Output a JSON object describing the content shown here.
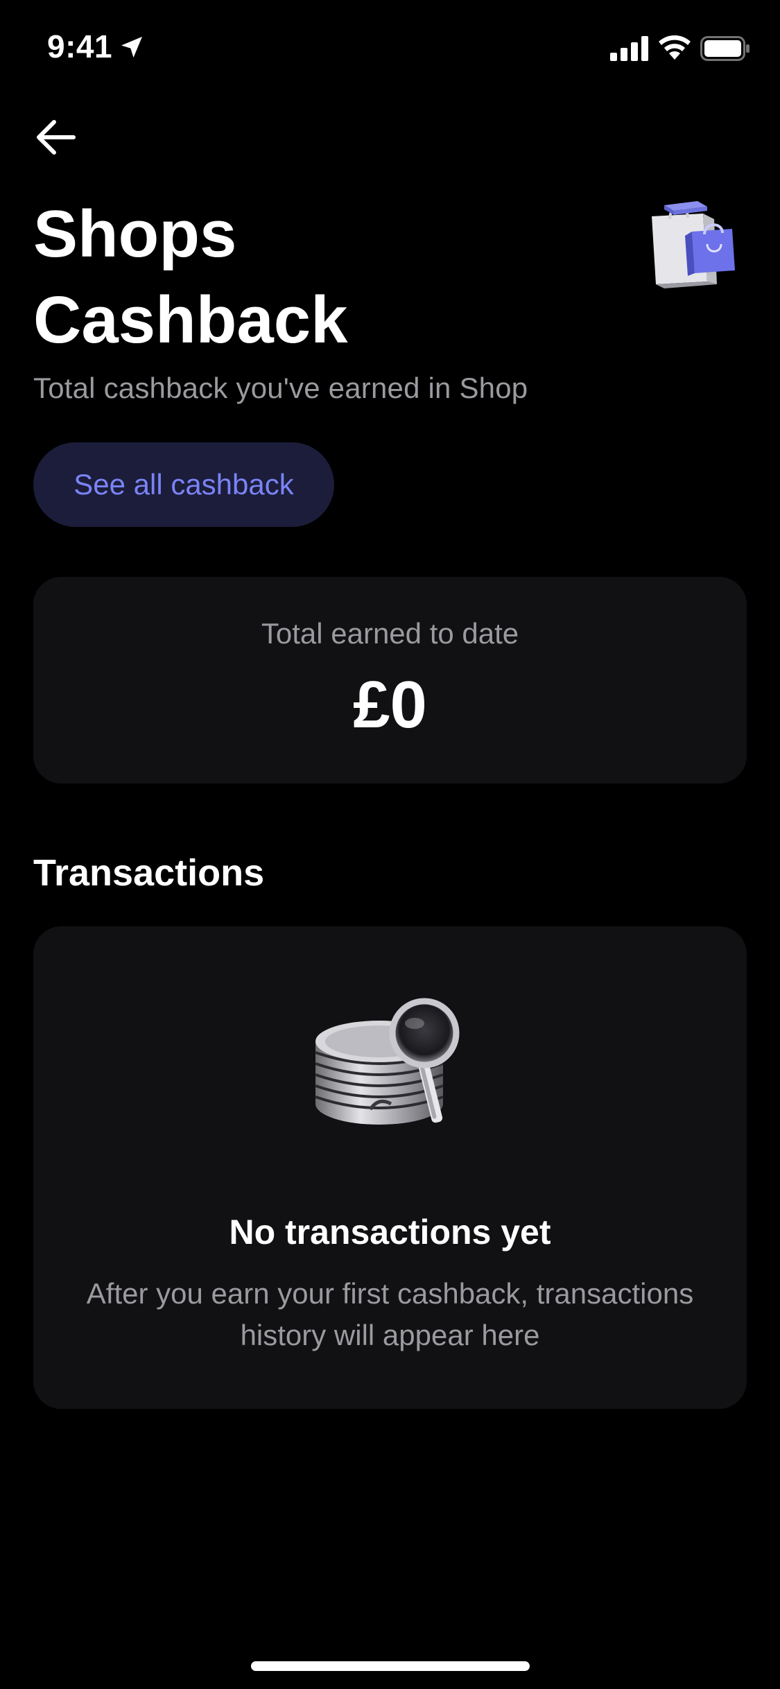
{
  "status_bar": {
    "time": "9:41"
  },
  "header": {
    "title_line1": "Shops",
    "title_line2": "Cashback",
    "subtitle": "Total cashback you've earned in Shop",
    "see_all_label": "See all cashback"
  },
  "total_card": {
    "label": "Total earned to date",
    "value": "£0"
  },
  "transactions": {
    "section_title": "Transactions",
    "empty_title": "No transactions yet",
    "empty_description": "After you earn your first cashback, transactions history will appear here"
  },
  "colors": {
    "background": "#000000",
    "card": "#111113",
    "accent_button_bg": "#1b1d3a",
    "accent_text": "#7b83f6",
    "secondary_text": "#9a9a9f"
  },
  "icons": {
    "back": "arrow-left-icon",
    "location": "location-arrow-icon",
    "signal": "cellular-signal-icon",
    "wifi": "wifi-icon",
    "battery": "battery-icon"
  }
}
